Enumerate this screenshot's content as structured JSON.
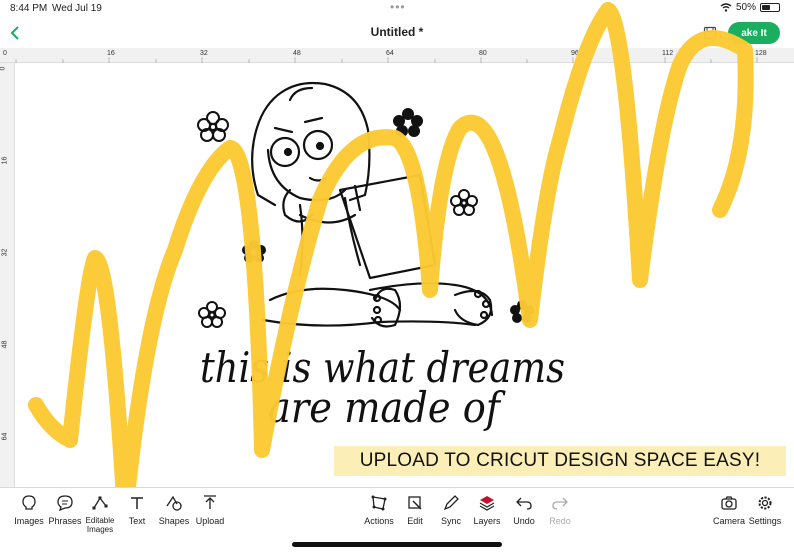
{
  "status_bar": {
    "time": "8:44 PM",
    "date": "Wed Jul 19",
    "battery_percent": "50%"
  },
  "title_bar": {
    "document_title": "Untitled *",
    "make_it_label": "ake It"
  },
  "rulers": {
    "horizontal": [
      "0",
      "16",
      "32",
      "48",
      "64",
      "80",
      "96",
      "112",
      "128"
    ],
    "vertical": [
      "0",
      "16",
      "32",
      "48",
      "64"
    ]
  },
  "canvas": {
    "design_text_line1": "this is what dreams",
    "design_text_line2": "are made of",
    "banner_text": "UPLOAD TO CRICUT DESIGN SPACE EASY!"
  },
  "toolbar": {
    "left": [
      {
        "label": "Images",
        "icon": "lightbulb-icon"
      },
      {
        "label": "Phrases",
        "icon": "speech-bubble-icon"
      },
      {
        "label": "Editable Images",
        "icon": "nodes-icon"
      },
      {
        "label": "Text",
        "icon": "text-icon"
      },
      {
        "label": "Shapes",
        "icon": "shapes-icon"
      },
      {
        "label": "Upload",
        "icon": "upload-icon"
      }
    ],
    "center": [
      {
        "label": "Actions",
        "icon": "actions-icon"
      },
      {
        "label": "Edit",
        "icon": "edit-icon"
      },
      {
        "label": "Sync",
        "icon": "pen-icon"
      },
      {
        "label": "Layers",
        "icon": "layers-icon"
      },
      {
        "label": "Undo",
        "icon": "undo-icon"
      },
      {
        "label": "Redo",
        "icon": "redo-icon"
      }
    ],
    "right": [
      {
        "label": "Camera",
        "icon": "camera-icon"
      },
      {
        "label": "Settings",
        "icon": "gear-icon"
      }
    ]
  },
  "colors": {
    "accent": "#1bae5e",
    "scribble": "#fbc933",
    "banner_bg": "#fbeeb6"
  }
}
